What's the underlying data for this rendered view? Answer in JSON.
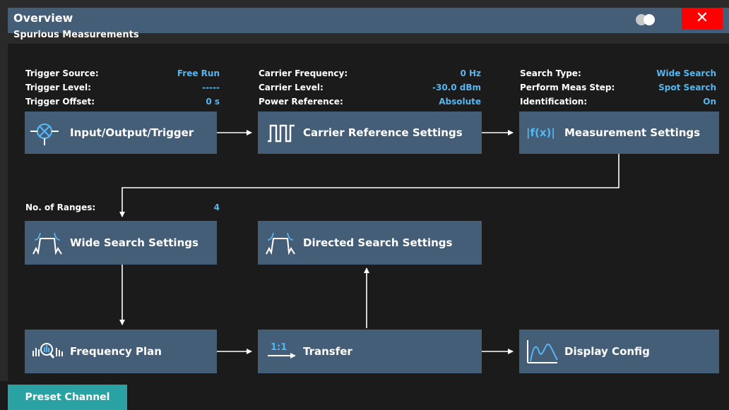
{
  "window": {
    "title": "Overview",
    "subtitle": "Spurious Measurements",
    "toggle_icon": "toggle-icon",
    "close_label": "✕"
  },
  "colors": {
    "titlebar": "#445e77",
    "block": "#445e77",
    "value_text": "#55b6f0",
    "close": "#ff0000",
    "preset": "#2aa1a3"
  },
  "trigger_info": [
    {
      "label": "Trigger Source:",
      "value": "Free Run"
    },
    {
      "label": "Trigger Level:",
      "value": "-----"
    },
    {
      "label": "Trigger Offset:",
      "value": "0 s"
    }
  ],
  "carrier_info": [
    {
      "label": "Carrier Frequency:",
      "value": "0 Hz"
    },
    {
      "label": "Carrier Level:",
      "value": "-30.0 dBm"
    },
    {
      "label": "Power Reference:",
      "value": "Absolute"
    }
  ],
  "measurement_info": [
    {
      "label": "Search Type:",
      "value": "Wide Search"
    },
    {
      "label": "Perform Meas Step:",
      "value": "Spot Search"
    },
    {
      "label": "Identification:",
      "value": "On"
    }
  ],
  "ranges_info": {
    "label": "No. of Ranges:",
    "value": "4"
  },
  "blocks": {
    "input_output_trigger": {
      "label": "Input/Output/Trigger",
      "icon": "input-output-icon"
    },
    "carrier_reference": {
      "label": "Carrier Reference Settings",
      "icon": "carrier-pulse-icon"
    },
    "measurement_settings": {
      "label": "Measurement Settings",
      "icon": "function-icon",
      "icon_text": "|f(x)|"
    },
    "wide_search": {
      "label": "Wide Search Settings",
      "icon": "spectrum-search-icon"
    },
    "directed_search": {
      "label": "Directed Search Settings",
      "icon": "spectrum-search-icon"
    },
    "frequency_plan": {
      "label": "Frequency Plan",
      "icon": "frequency-zoom-icon"
    },
    "transfer": {
      "label": "Transfer",
      "icon": "transfer-icon",
      "icon_text": "1:1"
    },
    "display_config": {
      "label": "Display Config",
      "icon": "display-curve-icon"
    }
  },
  "footer": {
    "preset_label": "Preset Channel"
  }
}
